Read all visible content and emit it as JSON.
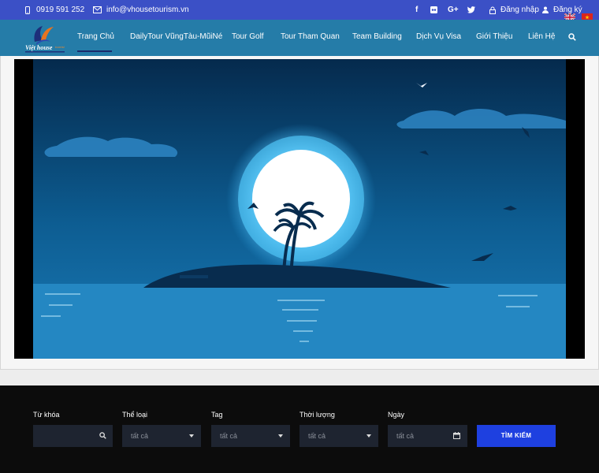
{
  "topbar": {
    "phone": "0919 591 252",
    "email": "info@vhousetourism.vn",
    "social": {
      "facebook": "f",
      "google_plus": "G+"
    },
    "login_label": "Đăng nhập",
    "register_label": "Đăng ký",
    "languages": [
      "english-flag",
      "vietnamese-flag"
    ]
  },
  "logo": {
    "text": "Việt house",
    "accent": "tourist"
  },
  "nav": {
    "items": [
      "Trang Chủ",
      "DailyTour VũngTàu-MũiNé",
      "Tour Golf",
      "Tour Tham Quan",
      "Team Building",
      "Dịch Vụ Visa",
      "Giới Thiệu",
      "Liên Hệ"
    ],
    "active_index": 0
  },
  "search": {
    "keyword_label": "Từ khóa",
    "keyword_value": "",
    "category_label": "Thể loại",
    "category_value": "tất cả",
    "tag_label": "Tag",
    "tag_value": "tất cả",
    "duration_label": "Thời lượng",
    "duration_value": "tất cả",
    "date_label": "Ngày",
    "date_value": "tất cả",
    "button_label": "TÌM KIẾM"
  },
  "colors": {
    "topbar": "#3b50c6",
    "navbar": "#257ca8",
    "search_bg": "#0c0c0c",
    "search_button": "#1e40e0"
  }
}
